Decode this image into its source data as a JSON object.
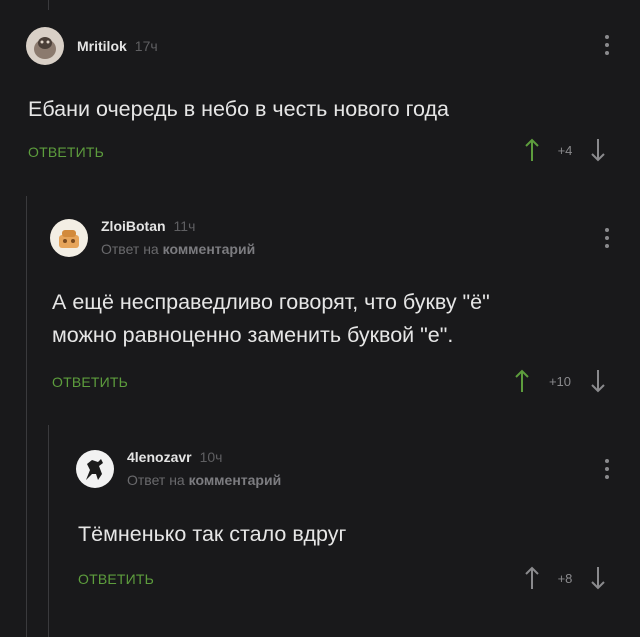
{
  "comments": [
    {
      "username": "Mritilok",
      "time": "17ч",
      "reply_prefix": "",
      "reply_link": "",
      "text_lines": [
        "Ебани очередь в небо в честь нового года"
      ],
      "reply_label": "ОТВЕТИТЬ",
      "score": "+4"
    },
    {
      "username": "ZloiBotan",
      "time": "11ч",
      "reply_prefix": "Ответ на",
      "reply_link": "комментарий",
      "text_lines": [
        "А ещё несправедливо говорят, что букву \"ё\"",
        "можно равноценно заменить буквой \"е\"."
      ],
      "reply_label": "ОТВЕТИТЬ",
      "score": "+10"
    },
    {
      "username": "4lenozavr",
      "time": "10ч",
      "reply_prefix": "Ответ на",
      "reply_link": "комментарий",
      "text_lines": [
        "Тёмненько так стало вдруг"
      ],
      "reply_label": "ОТВЕТИТЬ",
      "score": "+8"
    }
  ],
  "colors": {
    "background": "#19191b",
    "accent_green": "#5d9d3d",
    "text": "#e6e6e6",
    "muted": "#6a6a6d",
    "upvote_arrow": "#5d9d3d",
    "downvote_arrow": "#8a8a8d"
  },
  "icons": {
    "menu": "more-vertical-icon",
    "upvote": "arrow-up-icon",
    "downvote": "arrow-down-icon"
  }
}
